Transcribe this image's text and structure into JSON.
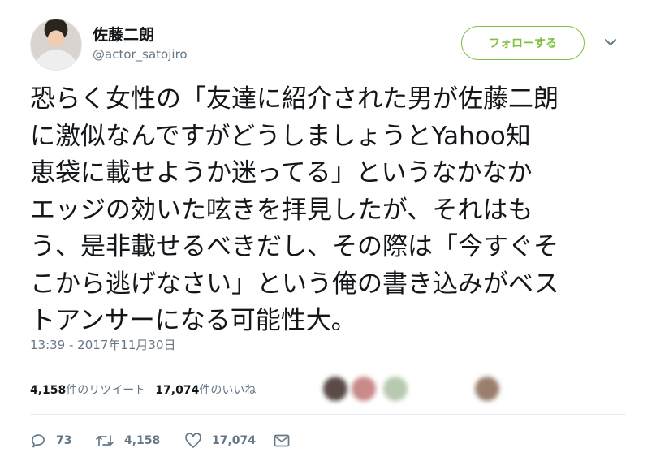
{
  "author": {
    "display_name": "佐藤二朗",
    "handle": "@actor_satojiro"
  },
  "follow_button_label": "フォローする",
  "tweet_lines": [
    "恐らく女性の「友達に紹介された男が佐藤二朗",
    "に激似なんですがどうしましょうとYahoo知",
    "恵袋に載せようか迷ってる」というなかなか",
    "エッジの効いた呟きを拝見したが、それはも",
    "う、是非載せるべきだし、その際は「今すぐそ",
    "こから逃げなさい」という俺の書き込みがベス",
    "トアンサーになる可能性大。"
  ],
  "timestamp": "13:39 - 2017年11月30日",
  "stats": {
    "retweet_count": "4,158",
    "retweet_label": "件のリツイート",
    "like_count": "17,074",
    "like_label": "件のいいね"
  },
  "actions": {
    "reply_count": "73",
    "retweet_count": "4,158",
    "like_count": "17,074"
  },
  "colors": {
    "follow_green": "#7fbf3f",
    "secondary_text": "#657786",
    "primary_text": "#14171a"
  }
}
